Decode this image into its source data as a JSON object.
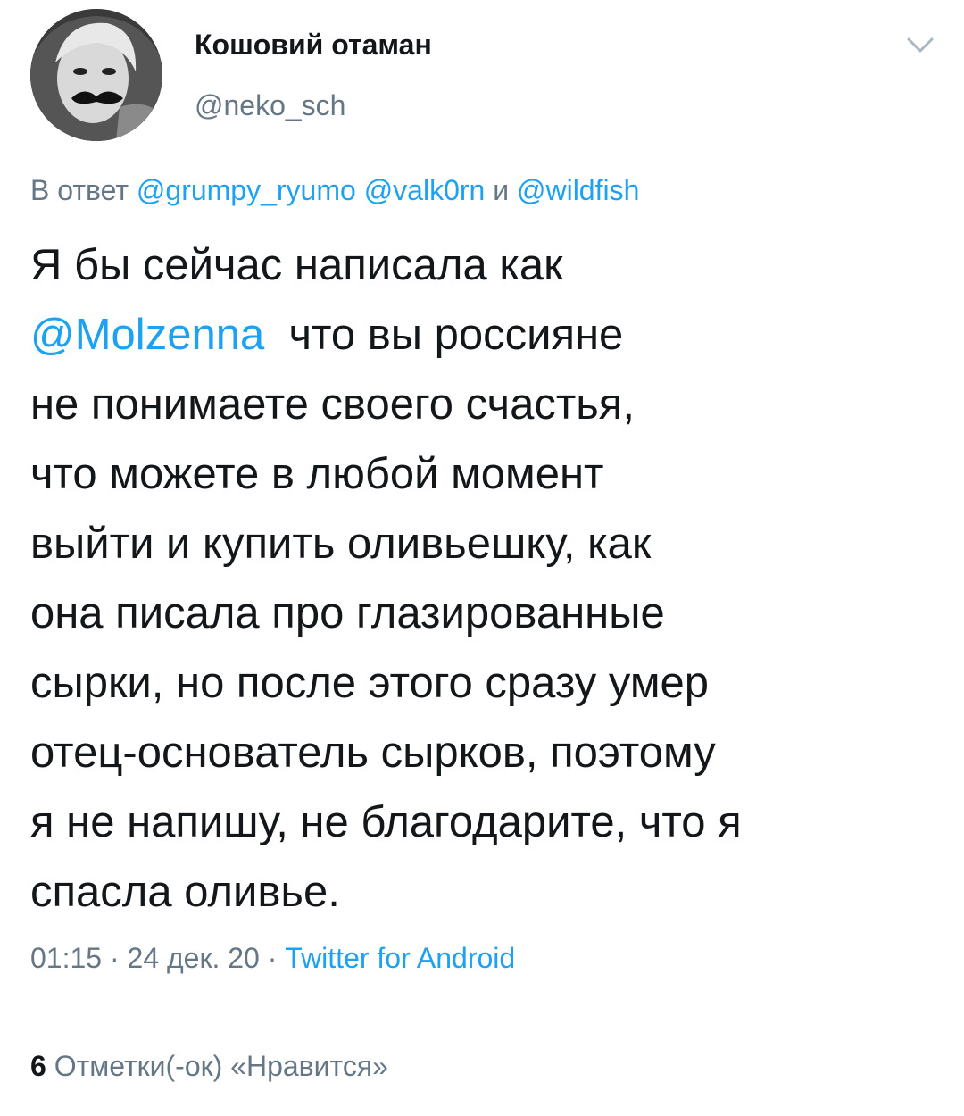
{
  "user": {
    "display_name": "Кошовий отаман",
    "handle": "@neko_sch",
    "avatar_icon": "user-avatar-photo"
  },
  "menu": {
    "icon": "chevron-down-icon"
  },
  "reply": {
    "prefix": "В ответ",
    "mention_1": "@grumpy_ryumo",
    "mention_2": "@valk0rn",
    "conjunction": "и",
    "mention_3": "@wildfish"
  },
  "tweet": {
    "line_1": "Я бы сейчас написала как",
    "mention": "@Molzenna",
    "line_2_rest": "что вы россияне",
    "line_3": "не понимаете своего счастья,",
    "line_4": "что можете в любой момент",
    "line_5": "выйти и купить оливьешку, как",
    "line_6": "она писала про глазированные",
    "line_7": "сырки, но после этого сразу умер",
    "line_8": "отец-основатель сырков, поэтому",
    "line_9": "я не напишу, не благодарите, что я",
    "line_10": "спасла оливье."
  },
  "meta": {
    "time": "01:15",
    "separator": "·",
    "date": "24 дек. 20",
    "source": "Twitter for Android"
  },
  "stats": {
    "likes_count": "6",
    "likes_label": "Отметки(-ок) «Нравится»"
  },
  "colors": {
    "text": "#14171a",
    "secondary": "#657786",
    "link": "#1da1f2",
    "divider": "#e1e8ed"
  }
}
